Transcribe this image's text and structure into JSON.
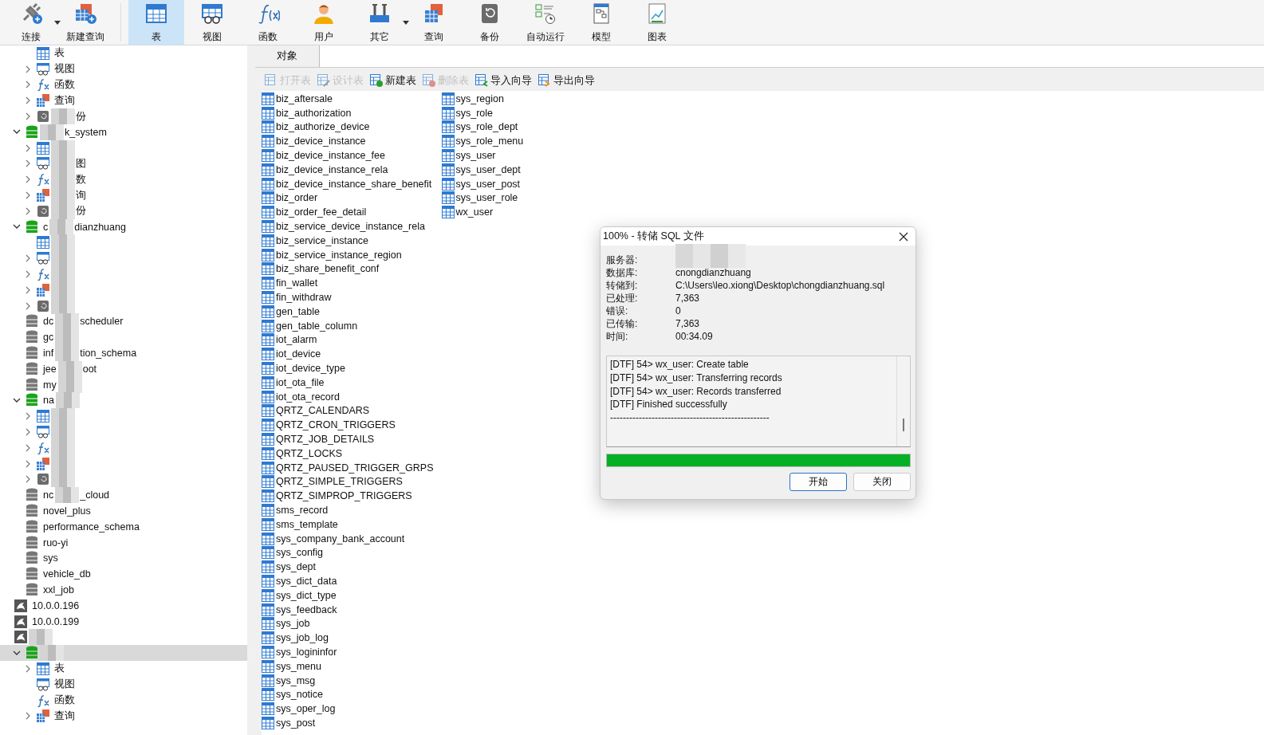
{
  "toolbar": [
    {
      "kind": "connect",
      "label": "连接",
      "dropdown": true,
      "selected": false
    },
    {
      "kind": "new_query",
      "label": "新建查询",
      "dropdown": false,
      "selected": false
    },
    {
      "kind": "table",
      "label": "表",
      "dropdown": false,
      "selected": true
    },
    {
      "kind": "view",
      "label": "视图",
      "dropdown": false,
      "selected": false
    },
    {
      "kind": "function",
      "label": "函数",
      "dropdown": false,
      "selected": false
    },
    {
      "kind": "user",
      "label": "用户",
      "dropdown": false,
      "selected": false
    },
    {
      "kind": "other",
      "label": "其它",
      "dropdown": true,
      "selected": false
    },
    {
      "kind": "query",
      "label": "查询",
      "dropdown": false,
      "selected": false
    },
    {
      "kind": "backup",
      "label": "备份",
      "dropdown": false,
      "selected": false
    },
    {
      "kind": "autorun",
      "label": "自动运行",
      "dropdown": false,
      "selected": false
    },
    {
      "kind": "model",
      "label": "模型",
      "dropdown": false,
      "selected": false
    },
    {
      "kind": "chart",
      "label": "图表",
      "dropdown": false,
      "selected": false
    }
  ],
  "tree": [
    {
      "kind": "table",
      "label": "表",
      "expandable": false,
      "selected": false
    },
    {
      "kind": "view",
      "label": "视图",
      "expandable": true,
      "selected": false
    },
    {
      "kind": "function",
      "label": "函数",
      "expandable": true,
      "selected": false
    },
    {
      "kind": "query",
      "label": "查询",
      "expandable": true,
      "selected": false
    },
    {
      "kind": "backup",
      "label_after": "份",
      "blurred": true,
      "expandable": true,
      "selected": false
    },
    {
      "kind": "database",
      "label_after": "k_system",
      "blurred": true,
      "open": true,
      "expanded": true,
      "selected": false,
      "children": [
        {
          "kind": "table",
          "blurred": true,
          "expandable": true,
          "selected": false
        },
        {
          "kind": "view",
          "label_after": "图",
          "blurred": true,
          "expandable": true,
          "selected": false
        },
        {
          "kind": "function",
          "label_after": "数",
          "blurred": true,
          "expandable": true,
          "selected": false
        },
        {
          "kind": "query",
          "label_after": "询",
          "blurred": true,
          "expandable": true,
          "selected": false
        },
        {
          "kind": "backup",
          "label_after": "份",
          "blurred": true,
          "expandable": true,
          "selected": false
        }
      ]
    },
    {
      "kind": "database",
      "label": "c",
      "label_after": "dianzhuang",
      "blurred": true,
      "open": true,
      "expanded": true,
      "selected": false,
      "children": [
        {
          "kind": "table",
          "blurred": true,
          "expandable": false,
          "selected": false
        },
        {
          "kind": "view",
          "blurred": true,
          "expandable": true,
          "selected": false
        },
        {
          "kind": "function",
          "blurred": true,
          "expandable": true,
          "selected": false
        },
        {
          "kind": "query",
          "blurred": true,
          "expandable": true,
          "selected": false
        },
        {
          "kind": "backup",
          "blurred": true,
          "expandable": true,
          "selected": false
        }
      ]
    },
    {
      "kind": "database",
      "label": "dc",
      "label_after": "scheduler",
      "blurred": true,
      "open": false,
      "expanded": false,
      "selected": false
    },
    {
      "kind": "database",
      "label": "gc",
      "blurred": true,
      "open": false,
      "expanded": false,
      "selected": false
    },
    {
      "kind": "database",
      "label": "inf",
      "label_after": "tion_schema",
      "blurred": true,
      "open": false,
      "expanded": false,
      "selected": false
    },
    {
      "kind": "database",
      "label": "jee",
      "label_after": "oot",
      "blurred": true,
      "open": false,
      "expanded": false,
      "selected": false
    },
    {
      "kind": "database",
      "label": "my",
      "blurred": true,
      "open": false,
      "expanded": false,
      "selected": false
    },
    {
      "kind": "database",
      "label": "na",
      "blurred": true,
      "open": true,
      "expanded": true,
      "selected": false,
      "children": [
        {
          "kind": "table",
          "blurred": true,
          "expandable": true,
          "selected": false
        },
        {
          "kind": "view",
          "blurred": true,
          "expandable": true,
          "selected": false
        },
        {
          "kind": "function",
          "blurred": true,
          "expandable": true,
          "selected": false
        },
        {
          "kind": "query",
          "blurred": true,
          "expandable": true,
          "selected": false
        },
        {
          "kind": "backup",
          "blurred": true,
          "expandable": true,
          "selected": false
        }
      ]
    },
    {
      "kind": "database",
      "label": "nc",
      "label_after": "_cloud",
      "blurred": true,
      "open": false,
      "expanded": false,
      "selected": false
    },
    {
      "kind": "database",
      "label": "novel_plus",
      "open": false,
      "expanded": false,
      "selected": false
    },
    {
      "kind": "database",
      "label": "performance_schema",
      "open": false,
      "expanded": false,
      "selected": false
    },
    {
      "kind": "database",
      "label": "ruo-yi",
      "open": false,
      "expanded": false,
      "selected": false
    },
    {
      "kind": "database",
      "label": "sys",
      "open": false,
      "expanded": false,
      "selected": false
    },
    {
      "kind": "database",
      "label": "vehicle_db",
      "open": false,
      "expanded": false,
      "selected": false
    },
    {
      "kind": "database",
      "label": "xxl_job",
      "open": false,
      "expanded": false,
      "selected": false
    },
    {
      "kind": "server",
      "label": "10.0.0.196",
      "selected": false
    },
    {
      "kind": "server",
      "label": "10.0.0.199",
      "selected": false
    },
    {
      "kind": "server",
      "blurred": true,
      "selected": false,
      "children": [
        {
          "kind": "database",
          "blurred": true,
          "open": true,
          "expanded": true,
          "selected": true,
          "children": [
            {
              "kind": "table",
              "label": "表",
              "expandable": true,
              "selected": false
            },
            {
              "kind": "view",
              "label": "视图",
              "expandable": false,
              "selected": false
            },
            {
              "kind": "function",
              "label": "函数",
              "expandable": false,
              "selected": false
            },
            {
              "kind": "query",
              "label": "查询",
              "expandable": true,
              "selected": false
            }
          ]
        }
      ]
    }
  ],
  "object_tab": {
    "label": "对象"
  },
  "actions": [
    {
      "kind": "open",
      "label": "打开表",
      "disabled": true
    },
    {
      "kind": "design",
      "label": "设计表",
      "disabled": true
    },
    {
      "kind": "new",
      "label": "新建表",
      "disabled": false
    },
    {
      "kind": "delete",
      "label": "删除表",
      "disabled": true
    },
    {
      "kind": "import",
      "label": "导入向导",
      "disabled": false
    },
    {
      "kind": "export",
      "label": "导出向导",
      "disabled": false
    }
  ],
  "tables": [
    "biz_aftersale",
    "biz_authorization",
    "biz_authorize_device",
    "biz_device_instance",
    "biz_device_instance_fee",
    "biz_device_instance_rela",
    "biz_device_instance_share_benefit",
    "biz_order",
    "biz_order_fee_detail",
    "biz_service_device_instance_rela",
    "biz_service_instance",
    "biz_service_instance_region",
    "biz_share_benefit_conf",
    "fin_wallet",
    "fin_withdraw",
    "gen_table",
    "gen_table_column",
    "iot_alarm",
    "iot_device",
    "iot_device_type",
    "iot_ota_file",
    "iot_ota_record",
    "QRTZ_CALENDARS",
    "QRTZ_CRON_TRIGGERS",
    "QRTZ_JOB_DETAILS",
    "QRTZ_LOCKS",
    "QRTZ_PAUSED_TRIGGER_GRPS",
    "QRTZ_SIMPLE_TRIGGERS",
    "QRTZ_SIMPROP_TRIGGERS",
    "sms_record",
    "sms_template",
    "sys_company_bank_account",
    "sys_config",
    "sys_dept",
    "sys_dict_data",
    "sys_dict_type",
    "sys_feedback",
    "sys_job",
    "sys_job_log",
    "sys_logininfor",
    "sys_menu",
    "sys_msg",
    "sys_notice",
    "sys_oper_log",
    "sys_post",
    "sys_region",
    "sys_role",
    "sys_role_dept",
    "sys_role_menu",
    "sys_user",
    "sys_user_dept",
    "sys_user_post",
    "sys_user_role",
    "wx_user"
  ],
  "dialog": {
    "title": "100% - 转储 SQL 文件",
    "fields": [
      {
        "label": "服务器:",
        "blurred": true
      },
      {
        "label": "数据库:",
        "value": "cnongdianzhuang"
      },
      {
        "label": "转储到:",
        "value": "C:\\Users\\leo.xiong\\Desktop\\chongdianzhuang.sql"
      },
      {
        "label": "已处理:",
        "value": "7,363"
      },
      {
        "label": "错误:",
        "value": "0"
      },
      {
        "label": "已传输:",
        "value": "7,363"
      },
      {
        "label": "时间:",
        "value": "00:34.09"
      }
    ],
    "log": [
      "[DTF] 54> wx_user: Create table",
      "[DTF] 54> wx_user: Transferring records",
      "[DTF] 54> wx_user: Records transferred",
      "[DTF] Finished successfully",
      "--------------------------------------------------"
    ],
    "progress": {
      "level": 1.0
    },
    "buttons": [
      {
        "label": "开始",
        "default": true
      },
      {
        "label": "关闭",
        "default": false
      }
    ]
  }
}
